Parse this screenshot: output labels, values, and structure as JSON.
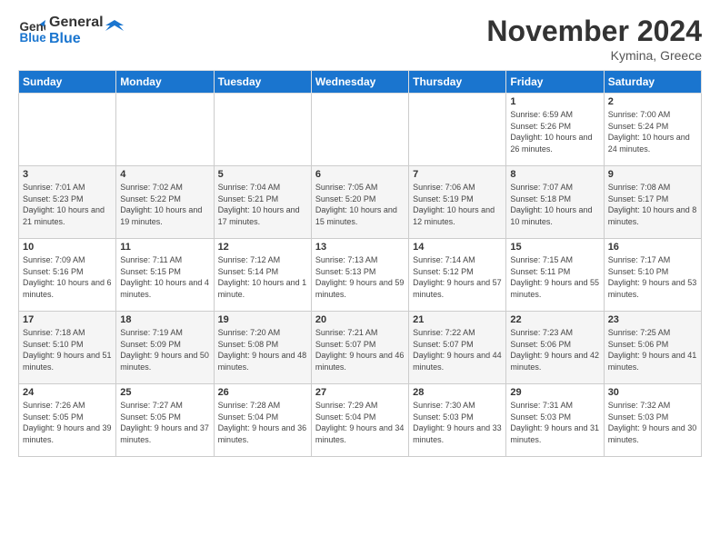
{
  "header": {
    "logo_line1": "General",
    "logo_line2": "Blue",
    "month_title": "November 2024",
    "location": "Kymina, Greece"
  },
  "days_of_week": [
    "Sunday",
    "Monday",
    "Tuesday",
    "Wednesday",
    "Thursday",
    "Friday",
    "Saturday"
  ],
  "weeks": [
    [
      {
        "day": "",
        "info": ""
      },
      {
        "day": "",
        "info": ""
      },
      {
        "day": "",
        "info": ""
      },
      {
        "day": "",
        "info": ""
      },
      {
        "day": "",
        "info": ""
      },
      {
        "day": "1",
        "info": "Sunrise: 6:59 AM\nSunset: 5:26 PM\nDaylight: 10 hours and 26 minutes."
      },
      {
        "day": "2",
        "info": "Sunrise: 7:00 AM\nSunset: 5:24 PM\nDaylight: 10 hours and 24 minutes."
      }
    ],
    [
      {
        "day": "3",
        "info": "Sunrise: 7:01 AM\nSunset: 5:23 PM\nDaylight: 10 hours and 21 minutes."
      },
      {
        "day": "4",
        "info": "Sunrise: 7:02 AM\nSunset: 5:22 PM\nDaylight: 10 hours and 19 minutes."
      },
      {
        "day": "5",
        "info": "Sunrise: 7:04 AM\nSunset: 5:21 PM\nDaylight: 10 hours and 17 minutes."
      },
      {
        "day": "6",
        "info": "Sunrise: 7:05 AM\nSunset: 5:20 PM\nDaylight: 10 hours and 15 minutes."
      },
      {
        "day": "7",
        "info": "Sunrise: 7:06 AM\nSunset: 5:19 PM\nDaylight: 10 hours and 12 minutes."
      },
      {
        "day": "8",
        "info": "Sunrise: 7:07 AM\nSunset: 5:18 PM\nDaylight: 10 hours and 10 minutes."
      },
      {
        "day": "9",
        "info": "Sunrise: 7:08 AM\nSunset: 5:17 PM\nDaylight: 10 hours and 8 minutes."
      }
    ],
    [
      {
        "day": "10",
        "info": "Sunrise: 7:09 AM\nSunset: 5:16 PM\nDaylight: 10 hours and 6 minutes."
      },
      {
        "day": "11",
        "info": "Sunrise: 7:11 AM\nSunset: 5:15 PM\nDaylight: 10 hours and 4 minutes."
      },
      {
        "day": "12",
        "info": "Sunrise: 7:12 AM\nSunset: 5:14 PM\nDaylight: 10 hours and 1 minute."
      },
      {
        "day": "13",
        "info": "Sunrise: 7:13 AM\nSunset: 5:13 PM\nDaylight: 9 hours and 59 minutes."
      },
      {
        "day": "14",
        "info": "Sunrise: 7:14 AM\nSunset: 5:12 PM\nDaylight: 9 hours and 57 minutes."
      },
      {
        "day": "15",
        "info": "Sunrise: 7:15 AM\nSunset: 5:11 PM\nDaylight: 9 hours and 55 minutes."
      },
      {
        "day": "16",
        "info": "Sunrise: 7:17 AM\nSunset: 5:10 PM\nDaylight: 9 hours and 53 minutes."
      }
    ],
    [
      {
        "day": "17",
        "info": "Sunrise: 7:18 AM\nSunset: 5:10 PM\nDaylight: 9 hours and 51 minutes."
      },
      {
        "day": "18",
        "info": "Sunrise: 7:19 AM\nSunset: 5:09 PM\nDaylight: 9 hours and 50 minutes."
      },
      {
        "day": "19",
        "info": "Sunrise: 7:20 AM\nSunset: 5:08 PM\nDaylight: 9 hours and 48 minutes."
      },
      {
        "day": "20",
        "info": "Sunrise: 7:21 AM\nSunset: 5:07 PM\nDaylight: 9 hours and 46 minutes."
      },
      {
        "day": "21",
        "info": "Sunrise: 7:22 AM\nSunset: 5:07 PM\nDaylight: 9 hours and 44 minutes."
      },
      {
        "day": "22",
        "info": "Sunrise: 7:23 AM\nSunset: 5:06 PM\nDaylight: 9 hours and 42 minutes."
      },
      {
        "day": "23",
        "info": "Sunrise: 7:25 AM\nSunset: 5:06 PM\nDaylight: 9 hours and 41 minutes."
      }
    ],
    [
      {
        "day": "24",
        "info": "Sunrise: 7:26 AM\nSunset: 5:05 PM\nDaylight: 9 hours and 39 minutes."
      },
      {
        "day": "25",
        "info": "Sunrise: 7:27 AM\nSunset: 5:05 PM\nDaylight: 9 hours and 37 minutes."
      },
      {
        "day": "26",
        "info": "Sunrise: 7:28 AM\nSunset: 5:04 PM\nDaylight: 9 hours and 36 minutes."
      },
      {
        "day": "27",
        "info": "Sunrise: 7:29 AM\nSunset: 5:04 PM\nDaylight: 9 hours and 34 minutes."
      },
      {
        "day": "28",
        "info": "Sunrise: 7:30 AM\nSunset: 5:03 PM\nDaylight: 9 hours and 33 minutes."
      },
      {
        "day": "29",
        "info": "Sunrise: 7:31 AM\nSunset: 5:03 PM\nDaylight: 9 hours and 31 minutes."
      },
      {
        "day": "30",
        "info": "Sunrise: 7:32 AM\nSunset: 5:03 PM\nDaylight: 9 hours and 30 minutes."
      }
    ]
  ]
}
